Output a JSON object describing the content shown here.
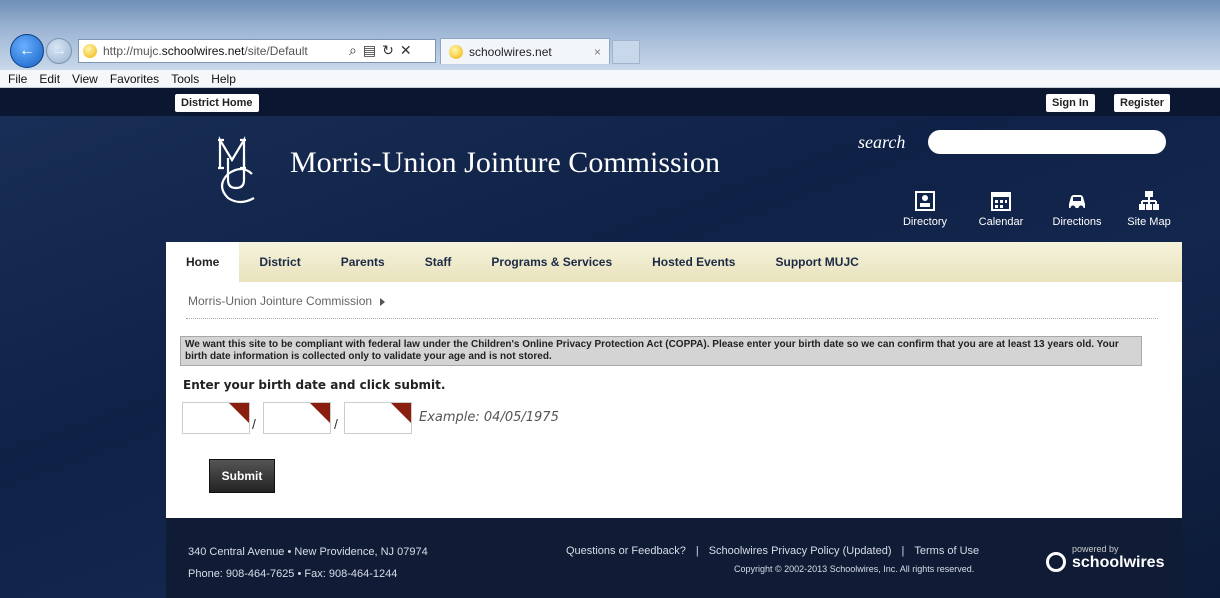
{
  "browser": {
    "url_prefix": "http://mujc.",
    "url_domain": "schoolwires.net",
    "url_suffix": "/site/Default",
    "tab_title": "schoolwires.net",
    "tab_close": "×",
    "menu": [
      "File",
      "Edit",
      "View",
      "Favorites",
      "Tools",
      "Help"
    ]
  },
  "topbar": {
    "district_home": "District Home",
    "sign_in": "Sign In",
    "register": "Register"
  },
  "header": {
    "title": "Morris-Union Jointure Commission",
    "search_label": "search",
    "quick_links": [
      {
        "label": "Directory",
        "icon": "directory-icon"
      },
      {
        "label": "Calendar",
        "icon": "calendar-icon"
      },
      {
        "label": "Directions",
        "icon": "car-icon"
      },
      {
        "label": "Site Map",
        "icon": "sitemap-icon"
      }
    ]
  },
  "nav": [
    "Home",
    "District",
    "Parents",
    "Staff",
    "Programs & Services",
    "Hosted Events",
    "Support MUJC"
  ],
  "breadcrumb": "Morris-Union Jointure Commission",
  "coppa_notice": "We want this site to be compliant with federal law under the Children's Online Privacy Protection Act (COPPA). Please enter your birth date so we can confirm that you are at least 13 years old. Your birth date information is collected only to validate your age and is not stored.",
  "form": {
    "heading": "Enter your birth date and click submit.",
    "separator": "/",
    "example": "Example: 04/05/1975",
    "submit": "Submit"
  },
  "footer": {
    "address": "340 Central Avenue • New Providence, NJ 07974",
    "phone": "Phone: 908-464-7625 • Fax: 908-464-1244",
    "link_feedback": "Questions or Feedback?",
    "separator": "|",
    "link_privacy": "Schoolwires Privacy Policy (Updated)",
    "link_terms": "Terms of Use",
    "copyright": "Copyright © 2002-2013 Schoolwires, Inc. All rights reserved.",
    "powered_small": "powered by",
    "powered_brand": "schoolwires"
  }
}
